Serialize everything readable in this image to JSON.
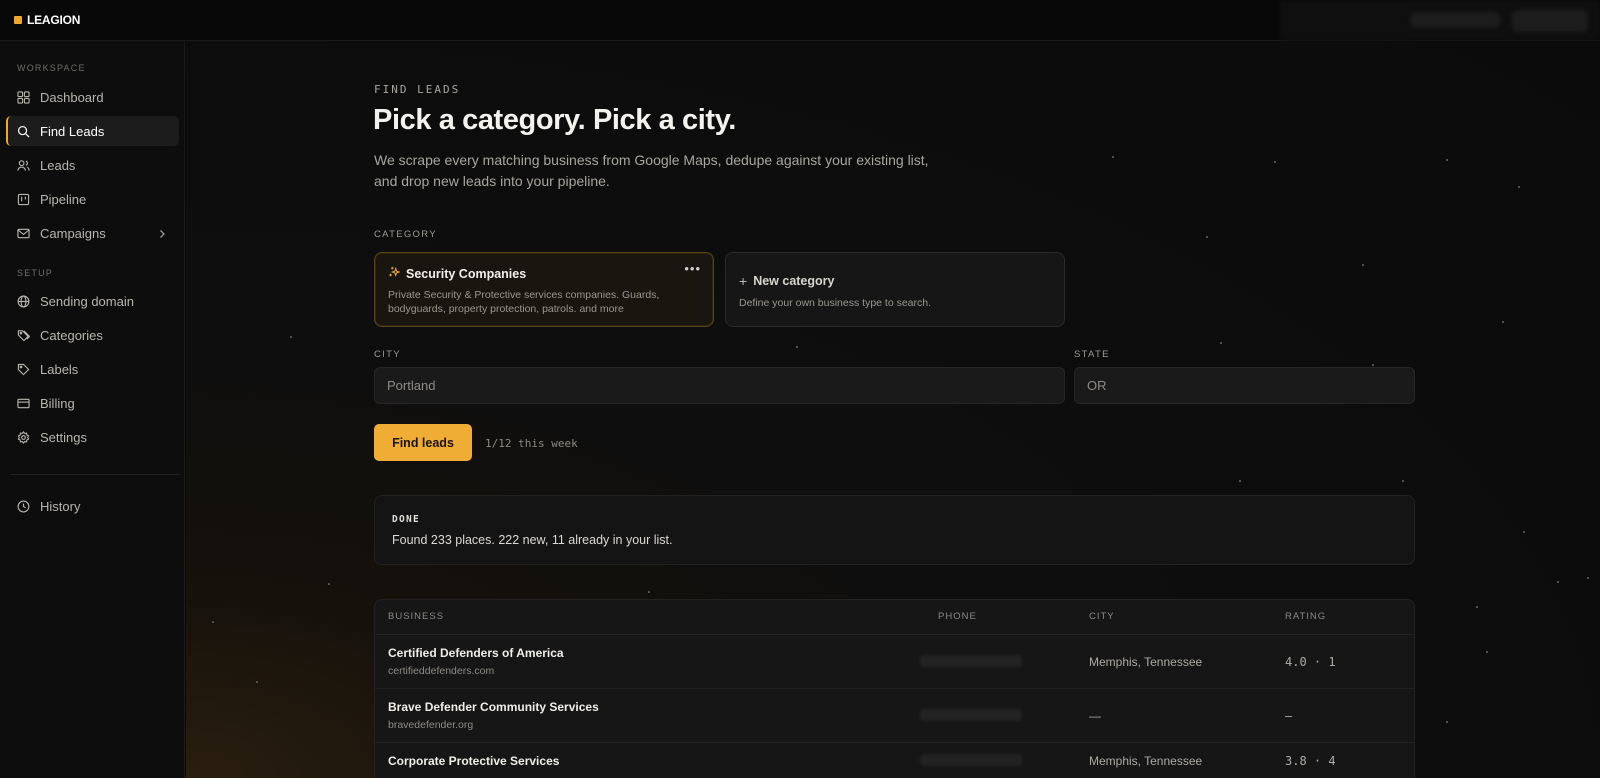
{
  "app": {
    "name": "LEAGION",
    "accent": "#f0a72b"
  },
  "sidebar": {
    "workspace_label": "WORKSPACE",
    "setup_label": "SETUP",
    "workspace_items": [
      {
        "label": "Dashboard",
        "icon": "grid-icon"
      },
      {
        "label": "Find Leads",
        "icon": "search-icon",
        "active": true
      },
      {
        "label": "Leads",
        "icon": "users-icon"
      },
      {
        "label": "Pipeline",
        "icon": "board-icon"
      },
      {
        "label": "Campaigns",
        "icon": "mail-icon",
        "has_submenu": true
      }
    ],
    "setup_items": [
      {
        "label": "Sending domain",
        "icon": "globe-icon"
      },
      {
        "label": "Categories",
        "icon": "tags-icon"
      },
      {
        "label": "Labels",
        "icon": "tag-icon"
      },
      {
        "label": "Billing",
        "icon": "card-icon"
      },
      {
        "label": "Settings",
        "icon": "gear-icon"
      }
    ],
    "history_label": "History"
  },
  "page": {
    "eyebrow": "FIND LEADS",
    "title": "Pick a category. Pick a city.",
    "subtitle": "We scrape every matching business from Google Maps, dedupe against your existing list, and drop new leads into your pipeline."
  },
  "category": {
    "label": "CATEGORY",
    "selected": {
      "title": "Security Companies",
      "description": "Private Security & Protective services companies. Guards, bodyguards, property protection, patrols. and more"
    },
    "new_card": {
      "title": "New category",
      "description": "Define your own business type to search."
    }
  },
  "location": {
    "city_label": "CITY",
    "city_value": "Portland",
    "state_label": "STATE",
    "state_value": "OR"
  },
  "action": {
    "button_label": "Find leads",
    "quota": "1/12 this week"
  },
  "status": {
    "tag": "DONE",
    "message": "Found 233 places.  222 new,  11 already in your list."
  },
  "table": {
    "headers": {
      "business": "BUSINESS",
      "phone": "PHONE",
      "city": "CITY",
      "rating": "RATING"
    },
    "rows": [
      {
        "name": "Certified Defenders of America",
        "url": "certifieddefenders.com",
        "city": "Memphis, Tennessee",
        "rating": "4.0 · 1"
      },
      {
        "name": "Brave Defender Community Services",
        "url": "bravedefender.org",
        "city": "—",
        "rating": "—"
      },
      {
        "name": "Corporate Protective Services",
        "url": "",
        "city": "Memphis, Tennessee",
        "rating": "3.8 · 4"
      }
    ]
  }
}
